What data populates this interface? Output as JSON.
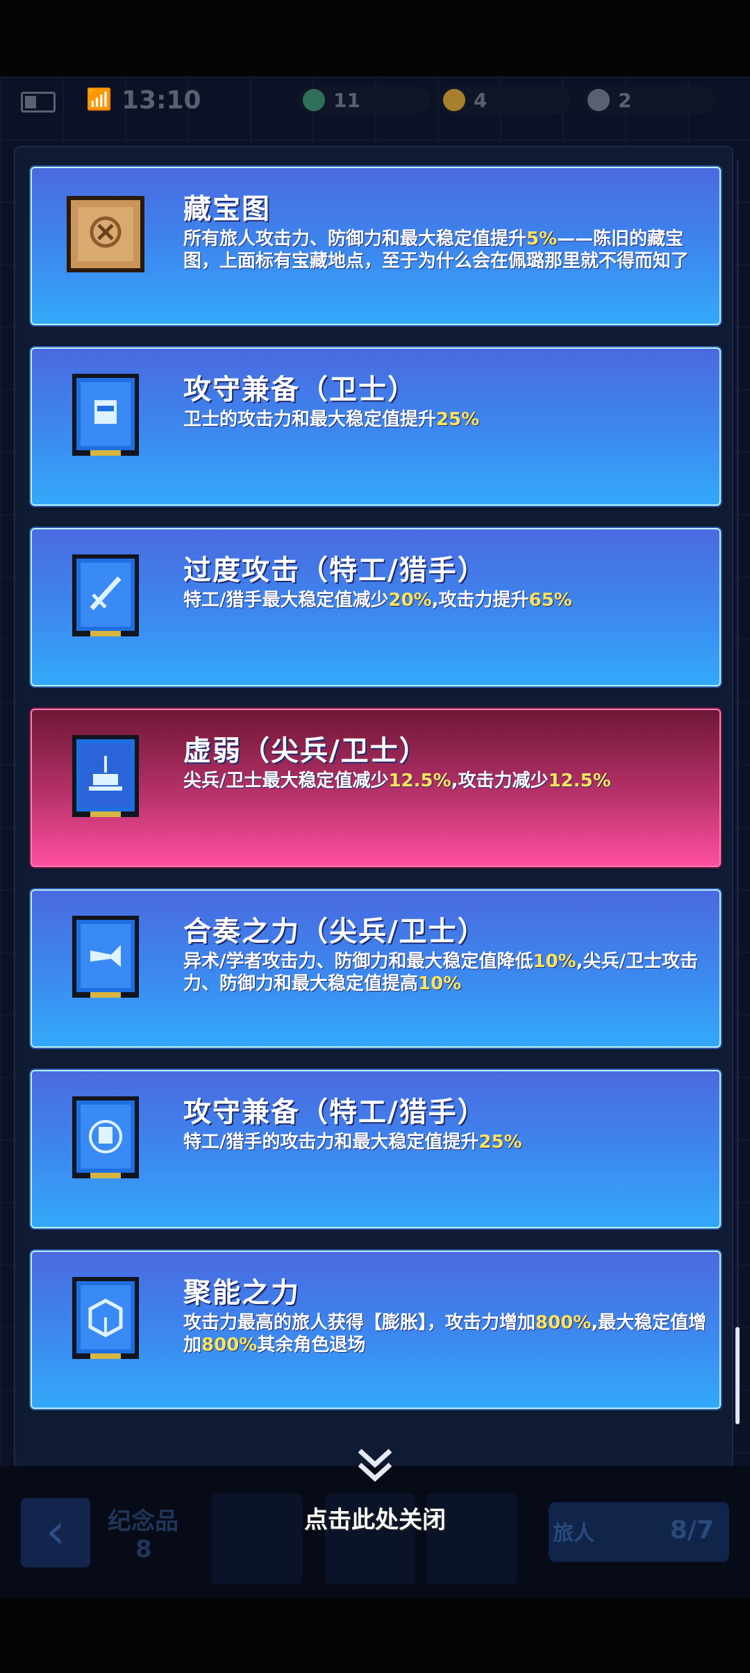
{
  "status": {
    "time": "13:10"
  },
  "resources": [
    {
      "icon": "gem-icon",
      "value": "11",
      "color": "#2f6f57"
    },
    {
      "icon": "gold-coin-icon",
      "value": "4",
      "color": "#a8802c"
    },
    {
      "icon": "token-icon",
      "value": "2",
      "color": "#5b6070"
    }
  ],
  "cards": [
    {
      "icon": "treasure-map-icon",
      "style": "blue",
      "title": "藏宝图",
      "desc": [
        {
          "t": "所有旅人攻击力、防御力和最大稳定值提升"
        },
        {
          "t": "5%",
          "hl": true
        },
        {
          "t": "——陈旧的藏宝图，上面标有宝藏地点，至于为什么会在佩璐那里就不得而知了"
        }
      ]
    },
    {
      "icon": "helmet-card-icon",
      "style": "blue",
      "title": "攻守兼备（卫士）",
      "desc": [
        {
          "t": "卫士的攻击力和最大稳定值提升"
        },
        {
          "t": "25%",
          "hl": true
        }
      ]
    },
    {
      "icon": "sword-card-icon",
      "style": "blue",
      "title": "过度攻击（特工/猎手）",
      "desc": [
        {
          "t": "特工/猎手最大稳定值减少"
        },
        {
          "t": "20%",
          "hl": true
        },
        {
          "t": ",攻击力提升"
        },
        {
          "t": "65%",
          "hl": true
        }
      ]
    },
    {
      "icon": "tower-card-icon",
      "style": "red",
      "title": "虚弱（尖兵/卫士）",
      "desc": [
        {
          "t": "尖兵/卫士最大稳定值减少"
        },
        {
          "t": "12.5%",
          "hl": true
        },
        {
          "t": ",攻击力减少"
        },
        {
          "t": "12.5%",
          "hl": true
        }
      ]
    },
    {
      "icon": "trumpet-card-icon",
      "style": "blue",
      "title": "合奏之力（尖兵/卫士）",
      "desc": [
        {
          "t": "异术/学者攻击力、防御力和最大稳定值降低"
        },
        {
          "t": "10%",
          "hl": true
        },
        {
          "t": ",尖兵/卫士攻击力、防御力和最大稳定值提高"
        },
        {
          "t": "10%",
          "hl": true
        }
      ]
    },
    {
      "icon": "shield-card-icon",
      "style": "blue",
      "title": "攻守兼备（特工/猎手）",
      "desc": [
        {
          "t": "特工/猎手的攻击力和最大稳定值提升"
        },
        {
          "t": "25%",
          "hl": true
        }
      ]
    },
    {
      "icon": "cube-card-icon",
      "style": "blue",
      "title": "聚能之力",
      "desc": [
        {
          "t": "攻击力最高的旅人获得【膨胀】，攻击力增加"
        },
        {
          "t": "800%",
          "hl": true
        },
        {
          "t": ",最大稳定值增加"
        },
        {
          "t": "800%",
          "hl": true
        },
        {
          "t": "其余角色退场"
        }
      ]
    }
  ],
  "bottom": {
    "souvenir_label": "纪念品",
    "souvenir_count": "8",
    "traveler_label": "旅人",
    "traveler_count": "8/7"
  },
  "close_label": "点击此处关闭"
}
